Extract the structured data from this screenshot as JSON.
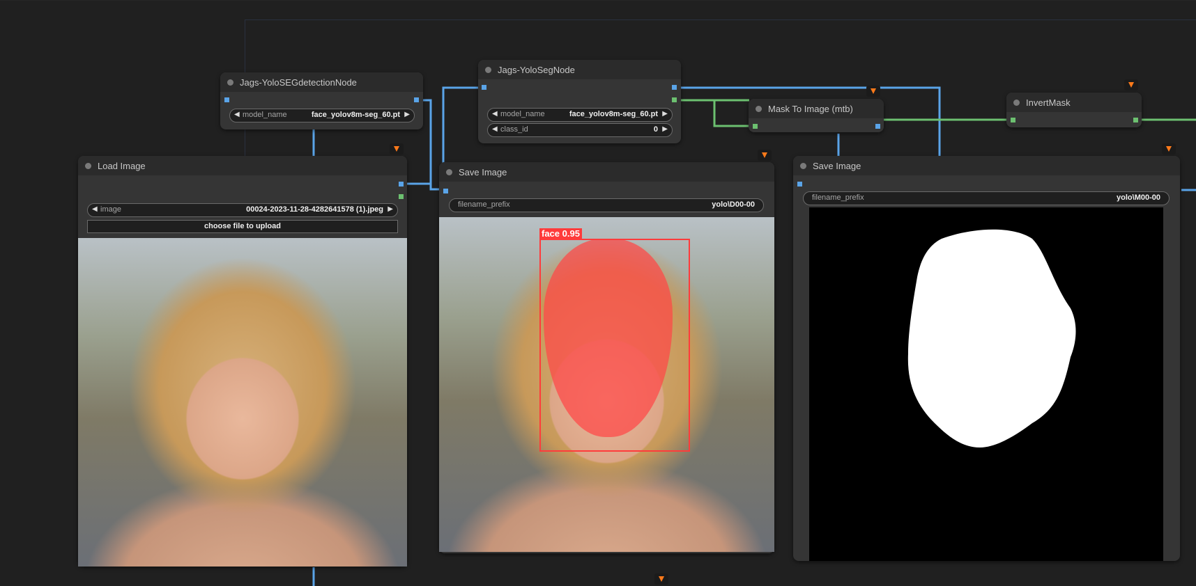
{
  "nodes": {
    "yolo_seg_detection": {
      "title": "Jags-YoloSEGdetectionNode",
      "widget_model": {
        "label": "model_name",
        "value": "face_yolov8m-seg_60.pt"
      }
    },
    "yolo_seg": {
      "title": "Jags-YoloSegNode",
      "widget_model": {
        "label": "model_name",
        "value": "face_yolov8m-seg_60.pt"
      },
      "widget_class": {
        "label": "class_id",
        "value": "0"
      }
    },
    "mask_to_image": {
      "title": "Mask To Image (mtb)"
    },
    "invert_mask": {
      "title": "InvertMask"
    },
    "load_image": {
      "title": "Load Image",
      "widget_image": {
        "label": "image",
        "value": "00024-2023-11-28-4282641578 (1).jpeg"
      },
      "upload_label": "choose file to upload"
    },
    "save_image_1": {
      "title": "Save Image",
      "widget_prefix": {
        "label": "filename_prefix",
        "value": "yolo\\D00-00"
      },
      "detection_label": "face  0.95"
    },
    "save_image_2": {
      "title": "Save Image",
      "widget_prefix": {
        "label": "filename_prefix",
        "value": "yolo\\M00-00"
      }
    }
  },
  "icons": {
    "fox": "fox-badge-icon",
    "arrow_left": "◀",
    "arrow_right": "▶"
  },
  "colors": {
    "canvas": "#202020",
    "node": "#353535",
    "link_image": "#5aa4e8",
    "link_mask": "#6cc070",
    "detection": "#ff3b3b"
  }
}
